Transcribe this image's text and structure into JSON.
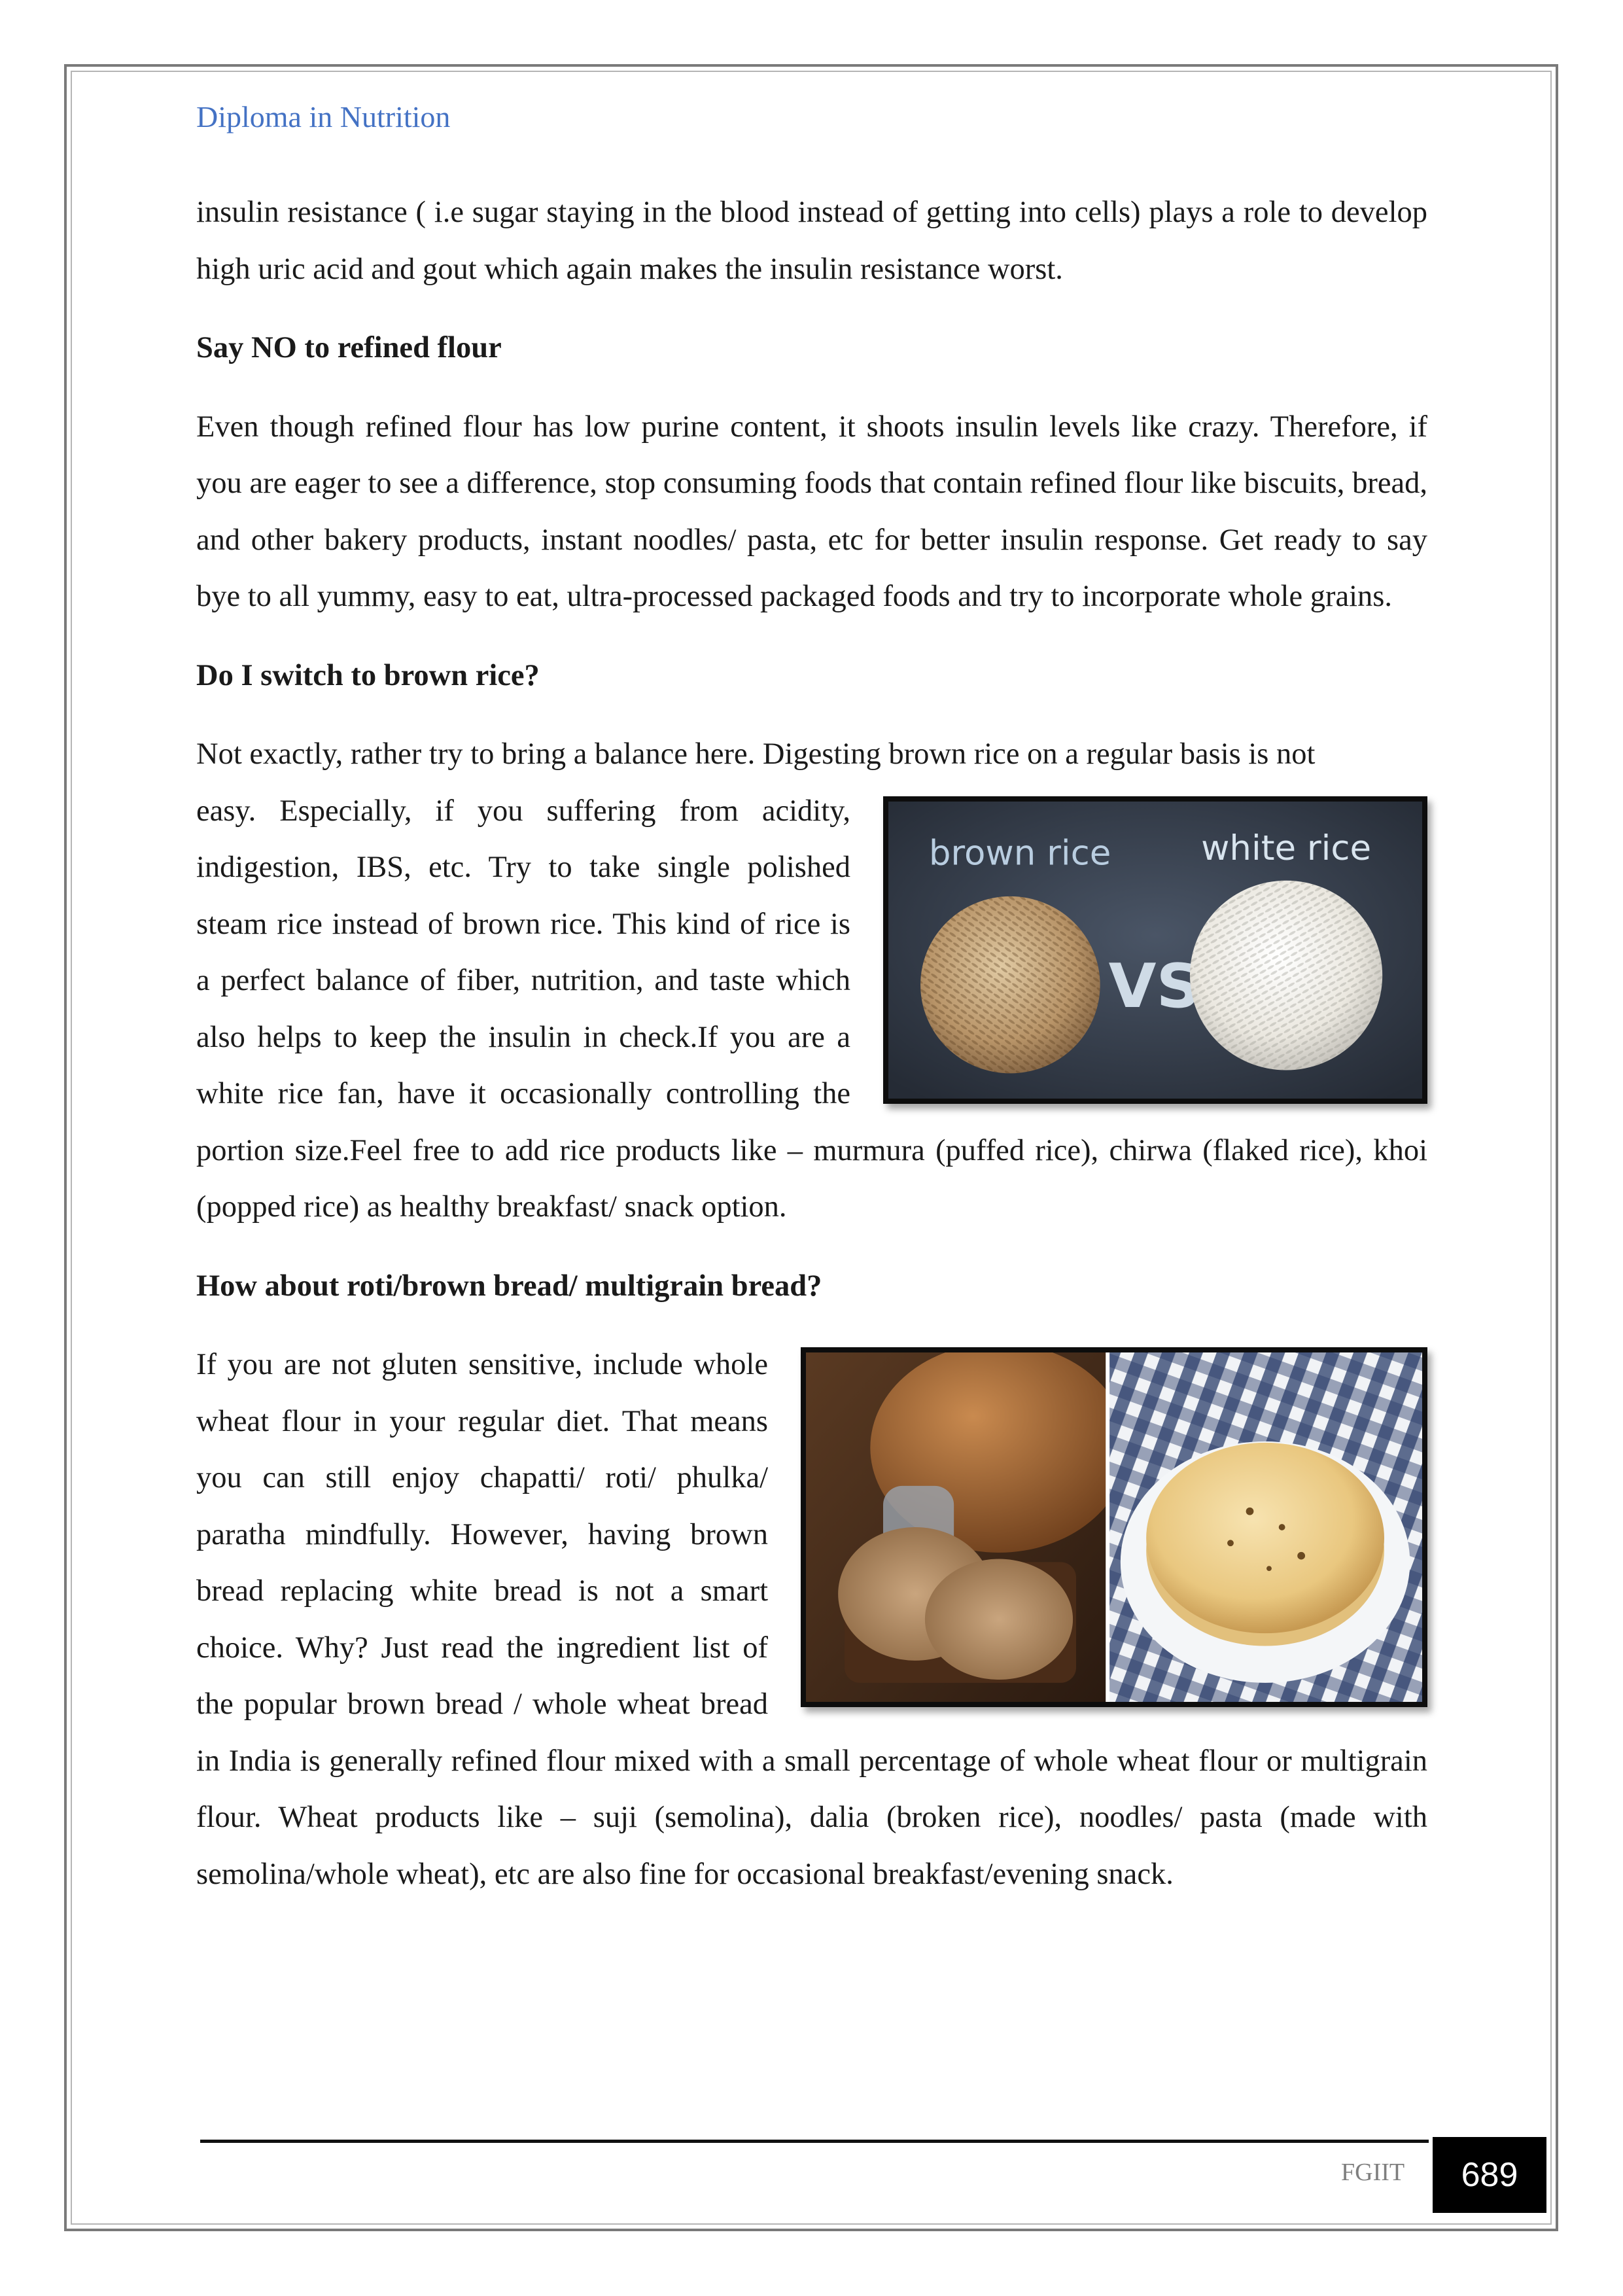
{
  "header": {
    "title": "Diploma in Nutrition"
  },
  "intro_paragraph": "insulin resistance ( i.e sugar staying in the blood instead of getting into cells) plays a role to develop high uric acid and gout which again makes the insulin resistance worst.",
  "sections": [
    {
      "heading": "Say NO to refined flour",
      "body": "Even though refined flour has low purine content, it shoots insulin levels like crazy. Therefore, if you are eager to see a difference, stop consuming foods that contain refined flour like biscuits, bread, and other bakery products, instant noodles/ pasta, etc for better insulin response.  Get ready to say bye to all yummy, easy to eat, ultra-processed packaged foods and try to incorporate whole grains."
    },
    {
      "heading": "Do I switch to brown rice?",
      "lead": "Not exactly, rather try to bring a balance here.  Digesting brown rice on a regular basis is not",
      "body": "easy.  Especially, if you suffering from acidity, indigestion, IBS, etc. Try to take single polished steam rice instead of brown rice. This kind of rice is a perfect balance of fiber, nutrition, and taste which also helps to keep the insulin in check.If you are a white rice fan, have it occasionally controlling the portion size.Feel free to add rice products like – murmura (puffed rice), chirwa (flaked rice), khoi (popped rice) as healthy breakfast/ snack option.",
      "image": {
        "left_label": "brown rice",
        "right_label": "white rice",
        "center_label": "VS"
      }
    },
    {
      "heading": "How about roti/brown bread/ multigrain bread?",
      "body": "If you are not gluten sensitive, include whole wheat flour in your regular diet. That means you can still enjoy chapatti/ roti/ phulka/ paratha mindfully. However, having brown bread replacing white bread is not a smart choice. Why? Just read the ingredient list of the popular brown bread / whole wheat bread in India is generally refined flour mixed with a small percentage of whole wheat flour or multigrain flour. Wheat products like – suji (semolina), dalia (broken rice), noodles/ pasta (made with semolina/whole wheat), etc are also fine for occasional breakfast/evening snack."
    }
  ],
  "footer": {
    "brand": "FGIIT",
    "page_number": "689"
  }
}
